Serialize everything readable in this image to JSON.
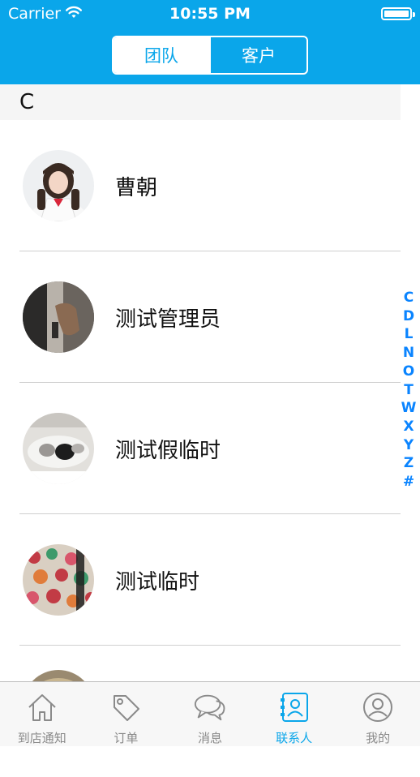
{
  "status_bar": {
    "carrier": "Carrier",
    "time": "10:55 PM"
  },
  "segmented": {
    "left_label": "团队",
    "right_label": "客户",
    "selected": "团队"
  },
  "section": {
    "letter": "C"
  },
  "contacts": [
    {
      "name": "曹朝",
      "avatar": "photo-avatar-girl"
    },
    {
      "name": "测试管理员",
      "avatar": "photo-avatar-hand"
    },
    {
      "name": "测试假临时",
      "avatar": "photo-avatar-cat"
    },
    {
      "name": "测试临时",
      "avatar": "photo-avatar-pattern"
    }
  ],
  "index_letters": [
    "C",
    "D",
    "L",
    "N",
    "O",
    "T",
    "W",
    "X",
    "Y",
    "Z",
    "#"
  ],
  "tabs": [
    {
      "label": "到店通知",
      "icon": "home-icon"
    },
    {
      "label": "订单",
      "icon": "tag-icon"
    },
    {
      "label": "消息",
      "icon": "chat-bubbles-icon"
    },
    {
      "label": "联系人",
      "icon": "contact-card-icon"
    },
    {
      "label": "我的",
      "icon": "profile-icon"
    }
  ],
  "active_tab": "联系人",
  "colors": {
    "brand_blue": "#0aa6ea",
    "index_blue": "#0a84ff",
    "tab_gray": "#8a8a8a"
  }
}
